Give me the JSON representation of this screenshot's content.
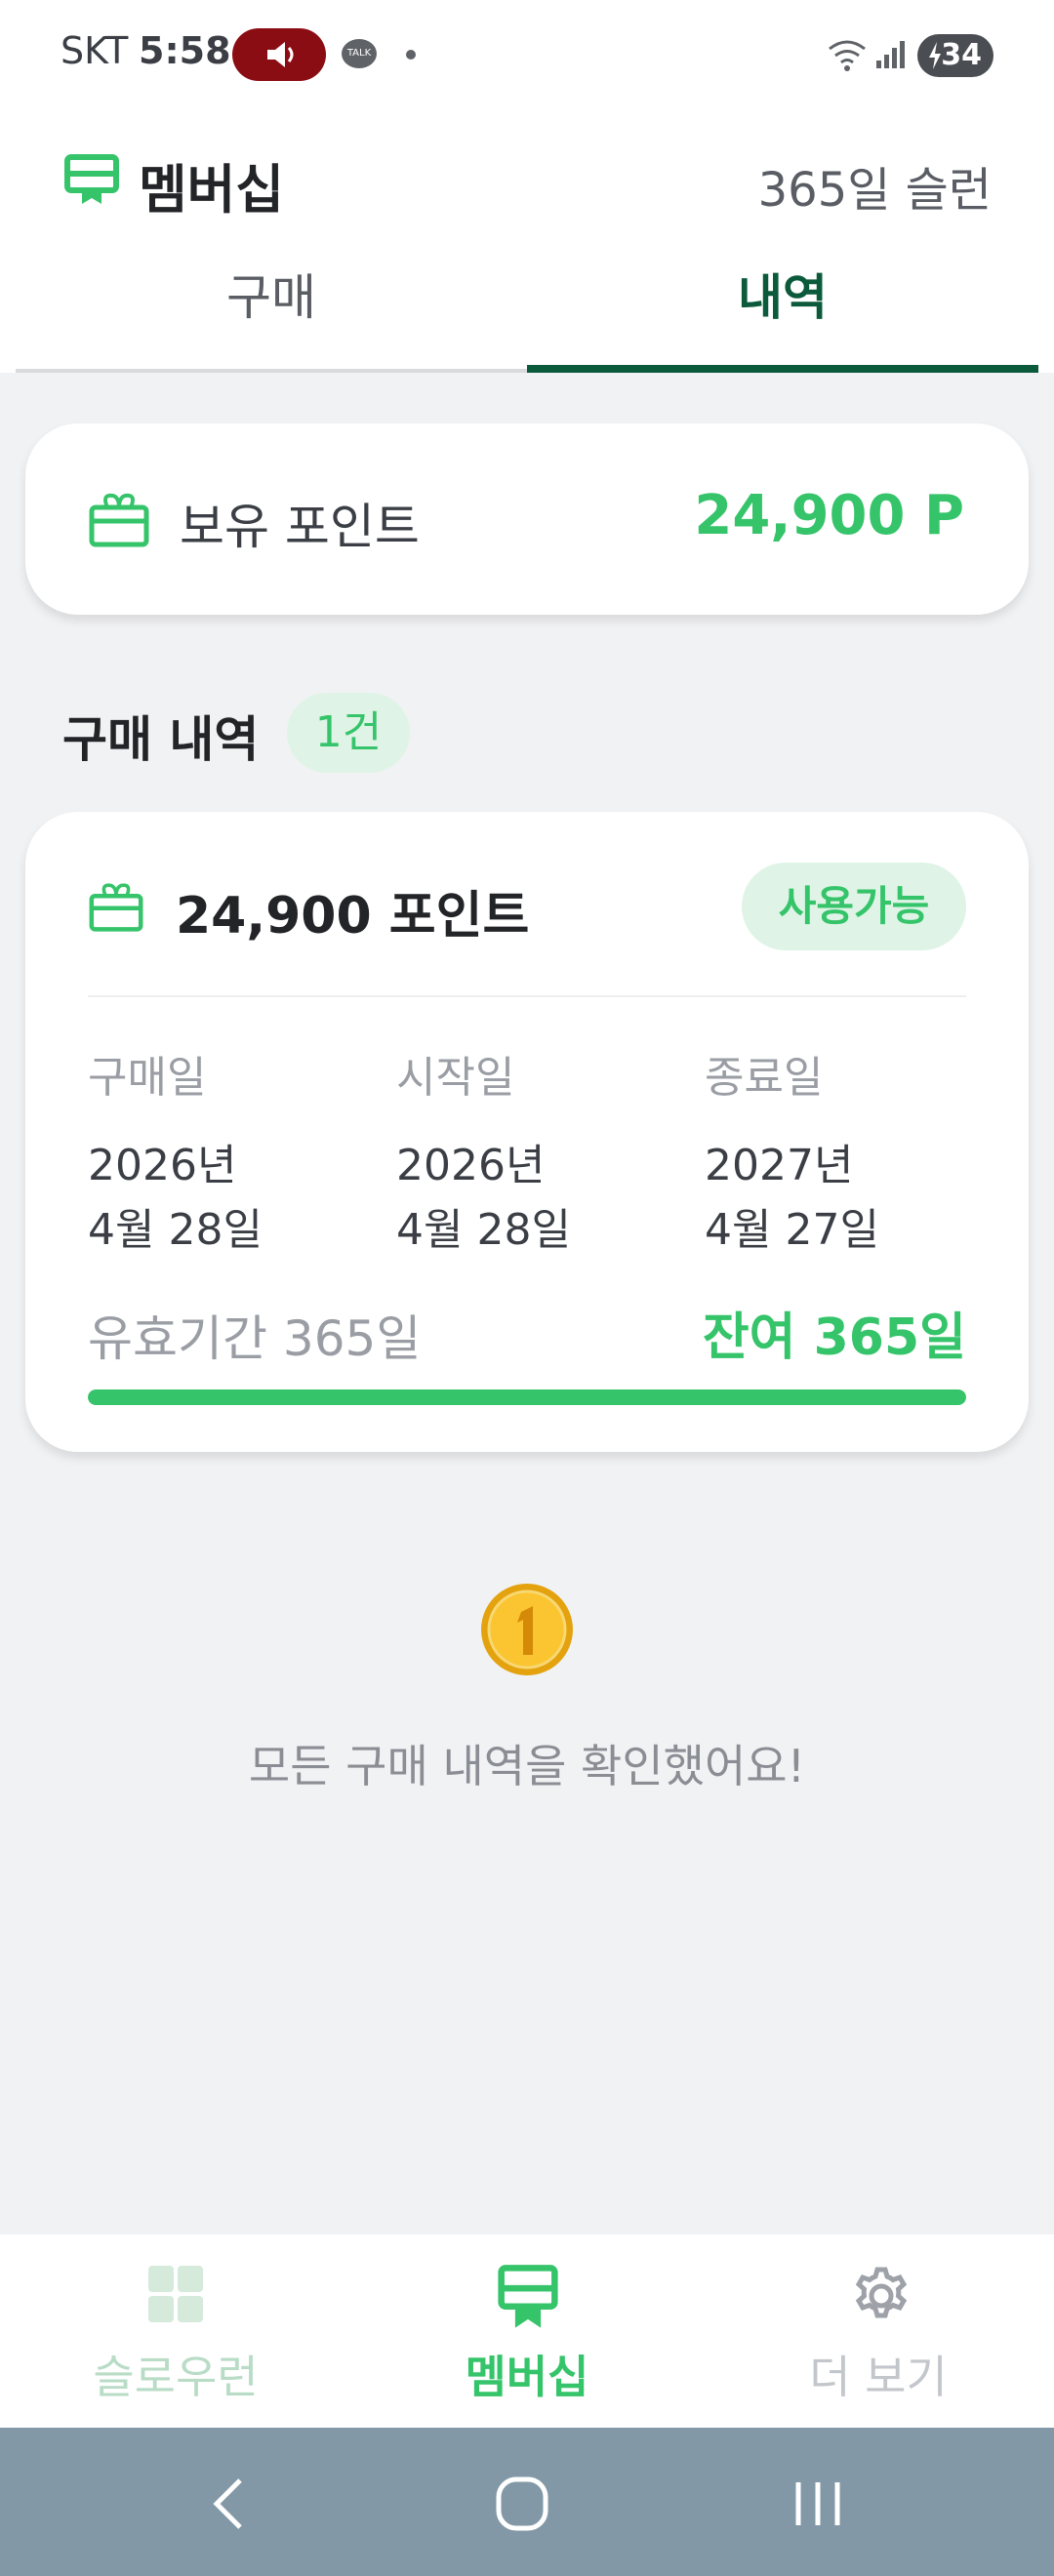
{
  "status_bar": {
    "carrier": "SKT",
    "time": "5:58",
    "battery": "34",
    "icons": [
      "sound-icon",
      "talk-icon",
      "wifi-icon",
      "signal-icon",
      "battery-icon"
    ]
  },
  "header": {
    "title": "멤버십",
    "right_text": "365일 슬런"
  },
  "tabs": [
    {
      "label": "구매",
      "active": false
    },
    {
      "label": "내역",
      "active": true
    }
  ],
  "points_card": {
    "label": "보유 포인트",
    "value": "24,900 P"
  },
  "purchase_section": {
    "title": "구매 내역",
    "count_badge": "1건"
  },
  "purchase_item": {
    "title": "24,900 포인트",
    "status": "사용가능",
    "dates": [
      {
        "label": "구매일",
        "line1": "2026년",
        "line2": "4월 28일"
      },
      {
        "label": "시작일",
        "line1": "2026년",
        "line2": "4월 28일"
      },
      {
        "label": "종료일",
        "line1": "2027년",
        "line2": "4월 27일"
      }
    ],
    "validity": "유효기간 365일",
    "remaining": "잔여 365일",
    "progress_fraction": 1.0
  },
  "empty_state": {
    "icon": "coin-icon",
    "message": "모든 구매 내역을 확인했어요!"
  },
  "bottom_nav": [
    {
      "label": "슬로우런",
      "icon": "grid-icon",
      "active": false
    },
    {
      "label": "멤버십",
      "icon": "membership-card-icon",
      "active": true
    },
    {
      "label": "더 보기",
      "icon": "gear-icon",
      "active": false
    }
  ],
  "colors": {
    "accent_green": "#35c46a",
    "tab_active": "#0b5a3b",
    "background": "#f1f2f4",
    "system_nav": "#8298a6"
  }
}
